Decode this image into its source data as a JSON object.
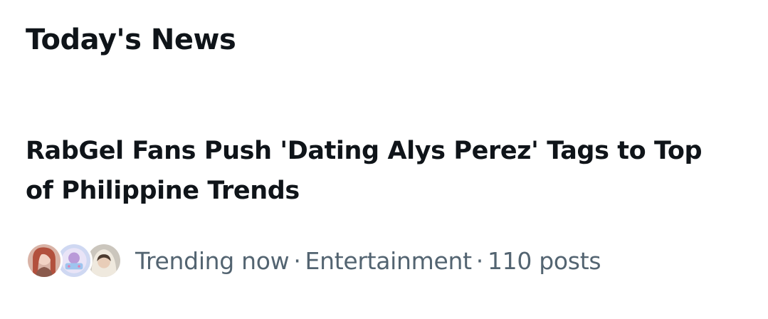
{
  "section": {
    "title": "Today's News"
  },
  "story": {
    "headline": "RabGel Fans Push 'Dating Alys Perez' Tags to Top of Philippine Trends",
    "status": "Trending now",
    "category": "Entertainment",
    "posts": "110 posts",
    "separator": "·",
    "avatars": [
      "avatar-1",
      "avatar-2",
      "avatar-3"
    ]
  }
}
